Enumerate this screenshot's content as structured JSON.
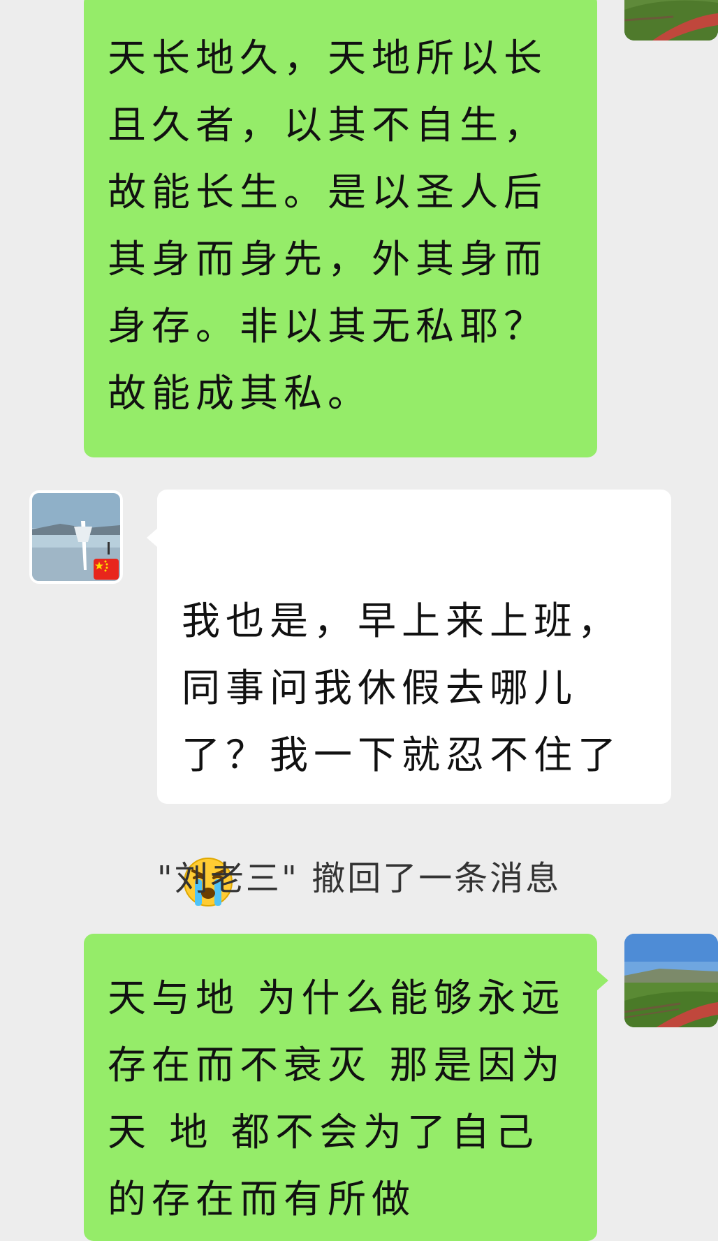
{
  "messages": [
    {
      "sender": "me",
      "text": "天长地久，天地所以长且久者，以其不自生，故能长生。是以圣人后其身而身先，外其身而身存。非以其无私耶？故能成其私。"
    },
    {
      "sender": "other",
      "text": "我也是，早上来上班，同事问我休假去哪儿了？我一下就忍不住了",
      "emoji": "crying-face",
      "avatar_badge": "china-flag"
    },
    {
      "sender": "me",
      "text": "天与地 为什么能够永远存在而不衰灭 那是因为 天 地 都不会为了自己的存在而有所做"
    }
  ],
  "system_notice": "\"刘老三\" 撤回了一条消息",
  "colors": {
    "background": "#ededed",
    "my_bubble": "#95ec69",
    "their_bubble": "#ffffff"
  }
}
